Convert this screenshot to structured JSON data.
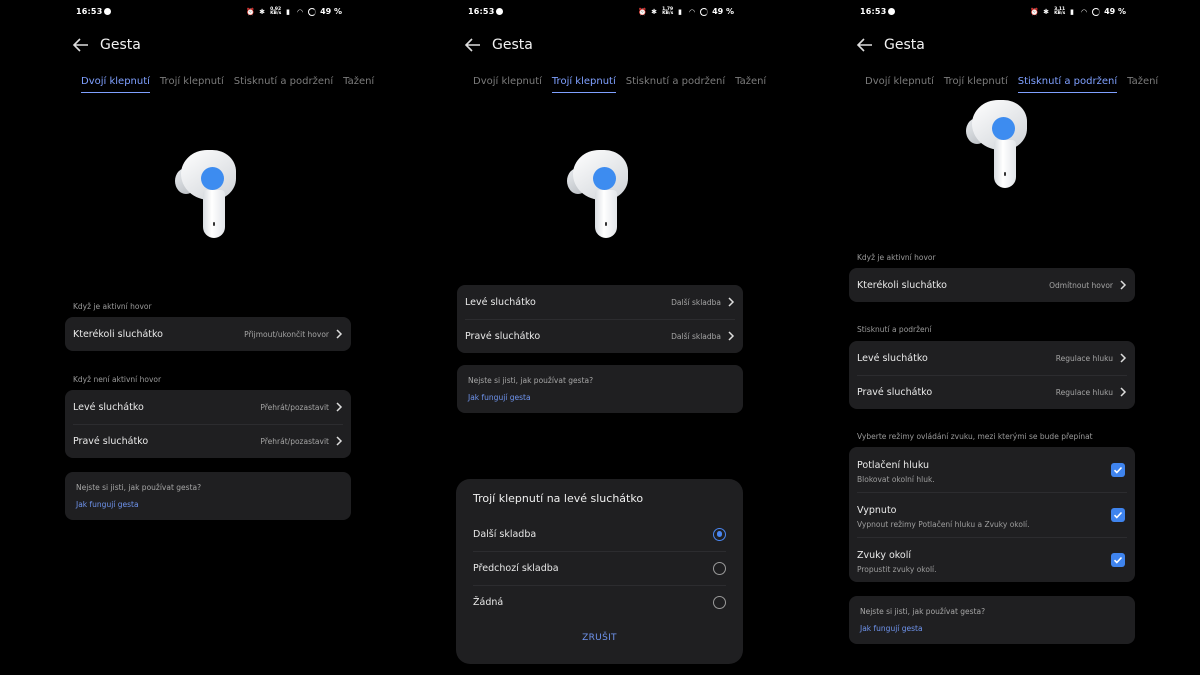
{
  "status": {
    "time": "16:53",
    "battery": "49 %",
    "speeds": [
      "0,92\nKB/s",
      "1,79\nKB/s",
      "3,11\nKB/s"
    ]
  },
  "header": {
    "title": "Gesta"
  },
  "tabs": [
    "Dvojí klepnutí",
    "Trojí klepnutí",
    "Stisknutí a podržení",
    "Tažení"
  ],
  "screen1": {
    "active_call_label": "Když je aktivní hovor",
    "any_earbud": {
      "label": "Kterékoli sluchátko",
      "value": "Přijmout/ukončit hovor"
    },
    "no_call_label": "Když není aktivní hovor",
    "left": {
      "label": "Levé sluchátko",
      "value": "Přehrát/pozastavit"
    },
    "right": {
      "label": "Pravé sluchátko",
      "value": "Přehrát/pozastavit"
    },
    "help_question": "Nejste si jisti, jak používat gesta?",
    "help_link": "Jak fungují gesta"
  },
  "screen2": {
    "left": {
      "label": "Levé sluchátko",
      "value": "Další skladba"
    },
    "right": {
      "label": "Pravé sluchátko",
      "value": "Další skladba"
    },
    "help_question": "Nejste si jisti, jak používat gesta?",
    "help_link": "Jak fungují gesta",
    "dialog": {
      "title": "Trojí klepnutí na levé sluchátko",
      "options": [
        "Další skladba",
        "Předchozí skladba",
        "Žádná"
      ],
      "selected_index": 0,
      "cancel": "ZRUŠIT"
    }
  },
  "screen3": {
    "active_call_label": "Když je aktivní hovor",
    "any_earbud": {
      "label": "Kterékoli sluchátko",
      "value": "Odmítnout hovor"
    },
    "hold_label": "Stisknutí a podržení",
    "left": {
      "label": "Levé sluchátko",
      "value": "Regulace hluku"
    },
    "right": {
      "label": "Pravé sluchátko",
      "value": "Regulace hluku"
    },
    "modes_label": "Vyberte režimy ovládání zvuku, mezi kterými se bude přepínat",
    "modes": [
      {
        "title": "Potlačení hluku",
        "subtitle": "Blokovat okolní hluk.",
        "checked": true
      },
      {
        "title": "Vypnuto",
        "subtitle": "Vypnout režimy Potlačení hluku a Zvuky okolí.",
        "checked": true
      },
      {
        "title": "Zvuky okolí",
        "subtitle": "Propustit zvuky okolí.",
        "checked": true
      }
    ],
    "help_question": "Nejste si jisti, jak používat gesta?",
    "help_link": "Jak fungují gesta"
  },
  "colors": {
    "accent": "#7fa0ff",
    "link": "#6f94ee",
    "checkbox": "#3f84ee",
    "card": "#1f1f21",
    "touch_area": "#3d8cf0"
  },
  "icons": [
    "back-arrow-icon",
    "chevron-right-icon",
    "checkbox-checked-icon",
    "radio-icon",
    "alarm-icon",
    "bluetooth-icon",
    "wifi-icon",
    "signal-icon"
  ]
}
